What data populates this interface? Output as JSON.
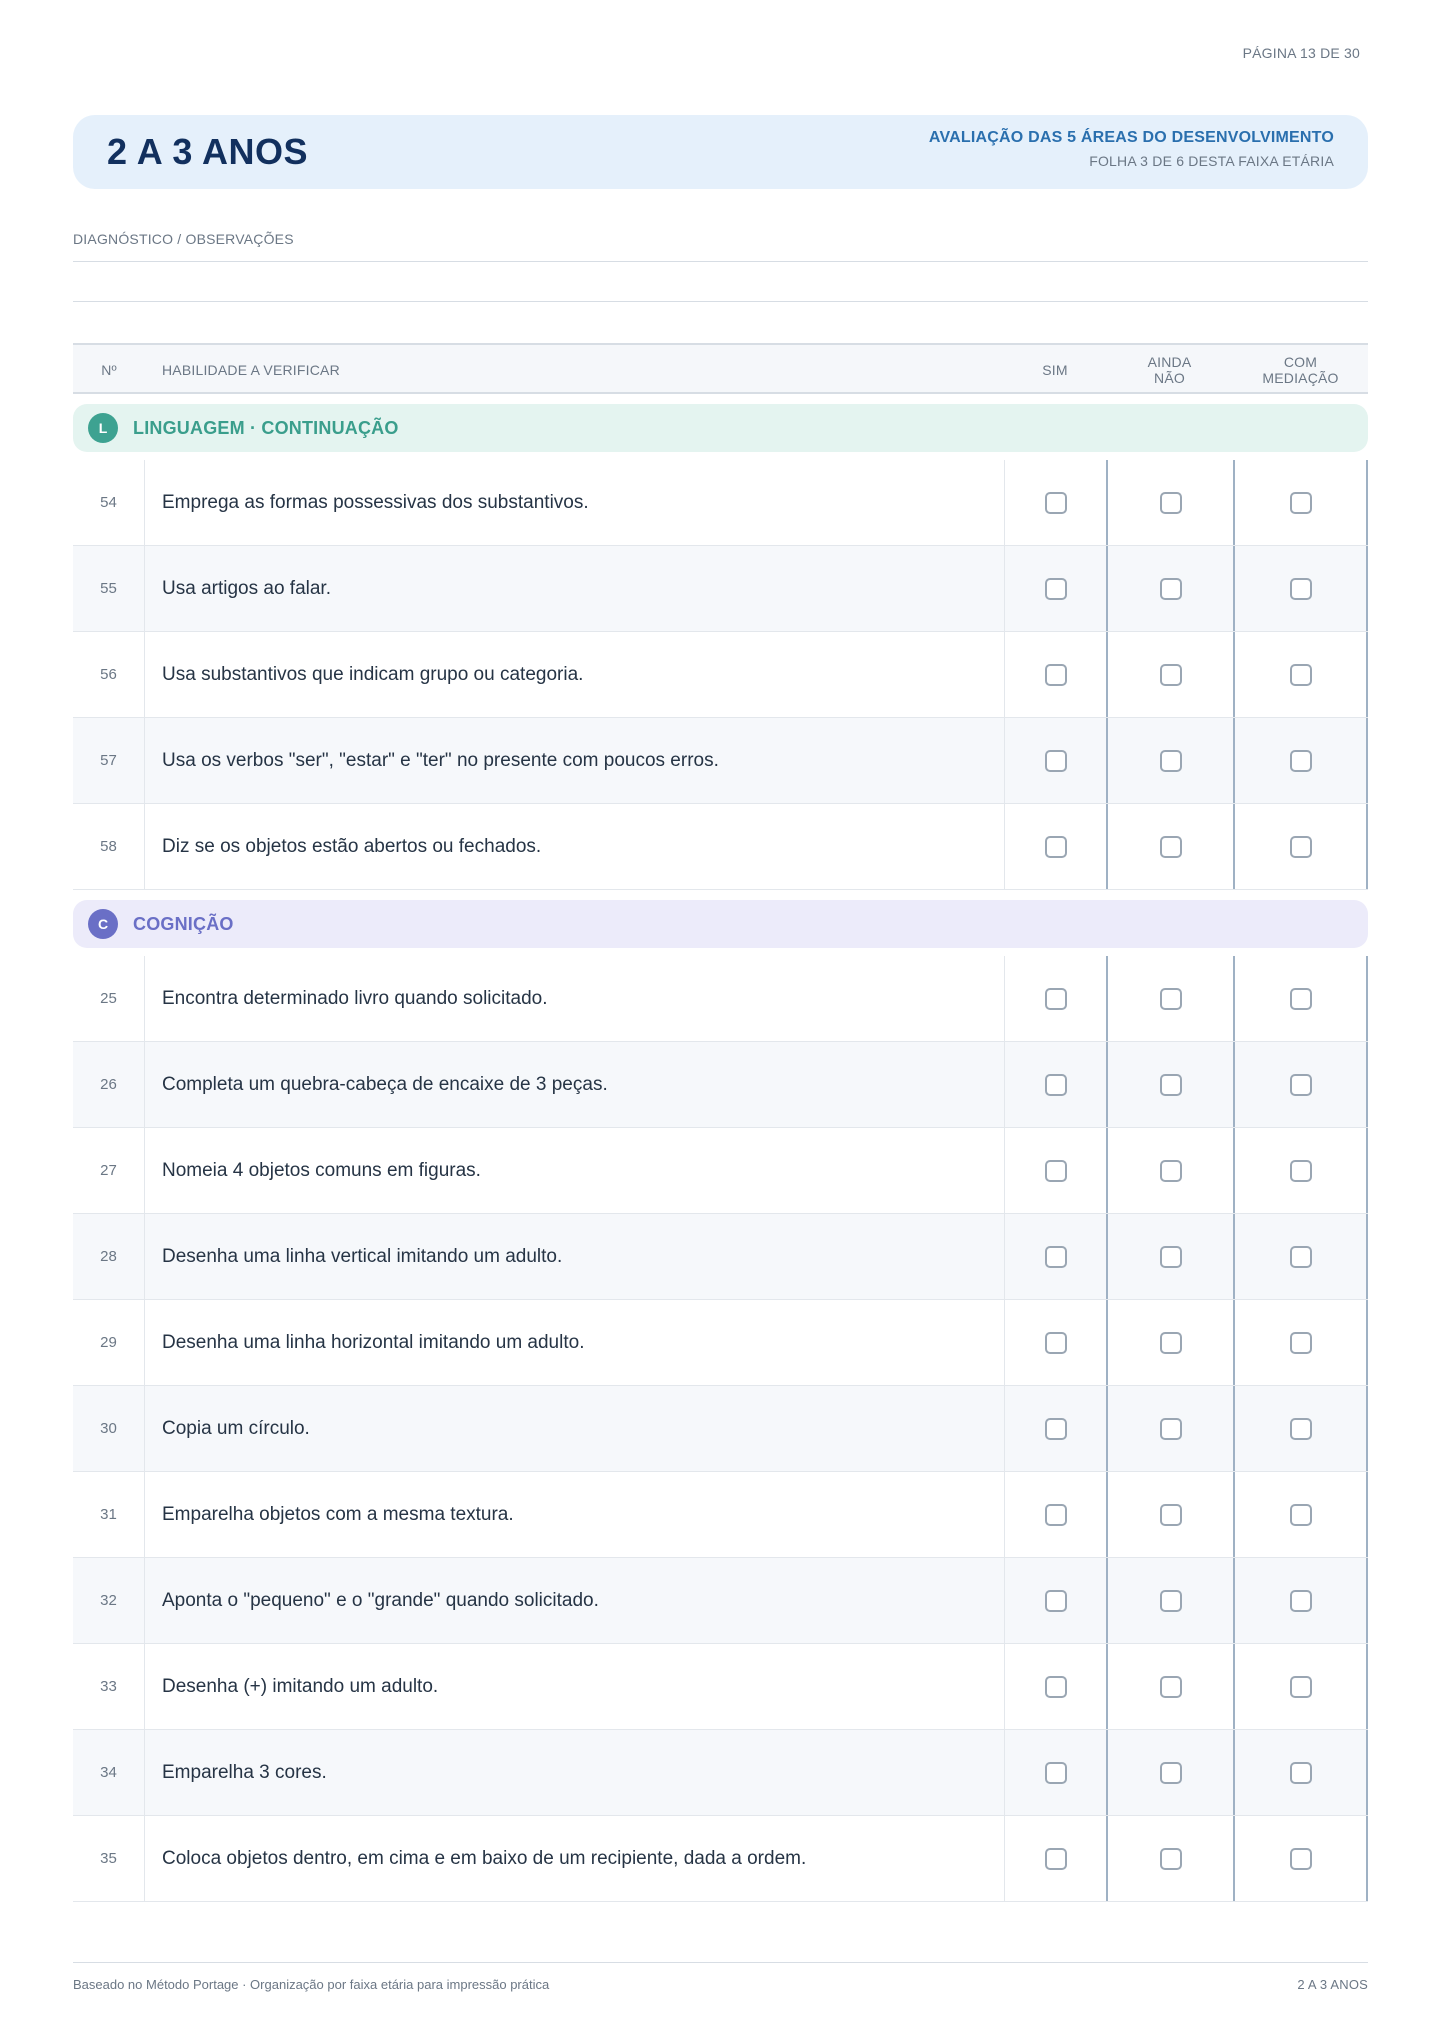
{
  "page": {
    "label": "PÁGINA 13 DE 30"
  },
  "header": {
    "title": "2 A 3 ANOS",
    "subtitle": "AVALIAÇÃO DAS 5 ÁREAS DO DESENVOLVIMENTO",
    "sheet": "FOLHA 3 DE 6 DESTA FAIXA ETÁRIA"
  },
  "diagnosis": {
    "label": "DIAGNÓSTICO / OBSERVAÇÕES"
  },
  "table": {
    "headers": {
      "num": "Nº",
      "skill": "HABILIDADE A VERIFICAR",
      "sim": "SIM",
      "ainda": "AINDA NÃO",
      "com": "COM MEDIAÇÃO"
    }
  },
  "sections": [
    {
      "badge": "L",
      "title": "LINGUAGEM · CONTINUAÇÃO",
      "rows": [
        {
          "n": "54",
          "text": "Emprega as formas possessivas dos substantivos."
        },
        {
          "n": "55",
          "text": "Usa artigos ao falar."
        },
        {
          "n": "56",
          "text": "Usa substantivos que indicam grupo ou categoria."
        },
        {
          "n": "57",
          "text": "Usa os verbos \"ser\", \"estar\" e \"ter\" no presente com poucos erros."
        },
        {
          "n": "58",
          "text": "Diz se os objetos estão abertos ou fechados."
        }
      ]
    },
    {
      "badge": "C",
      "title": "COGNIÇÃO",
      "rows": [
        {
          "n": "25",
          "text": "Encontra determinado livro quando solicitado."
        },
        {
          "n": "26",
          "text": "Completa um quebra-cabeça de encaixe de 3 peças."
        },
        {
          "n": "27",
          "text": "Nomeia 4 objetos comuns em figuras."
        },
        {
          "n": "28",
          "text": "Desenha uma linha vertical imitando um adulto."
        },
        {
          "n": "29",
          "text": "Desenha uma linha horizontal imitando um adulto."
        },
        {
          "n": "30",
          "text": "Copia um círculo."
        },
        {
          "n": "31",
          "text": "Emparelha objetos com a mesma textura."
        },
        {
          "n": "32",
          "text": "Aponta o \"pequeno\" e o \"grande\" quando solicitado."
        },
        {
          "n": "33",
          "text": "Desenha (+) imitando um adulto."
        },
        {
          "n": "34",
          "text": "Emparelha 3 cores."
        },
        {
          "n": "35",
          "text": "Coloca objetos dentro, em cima e em baixo de um recipiente, dada a ordem."
        }
      ]
    }
  ],
  "footer": {
    "left": "Baseado no Método Portage · Organização por faixa etária para impressão prática",
    "right": "2 A 3 ANOS"
  }
}
